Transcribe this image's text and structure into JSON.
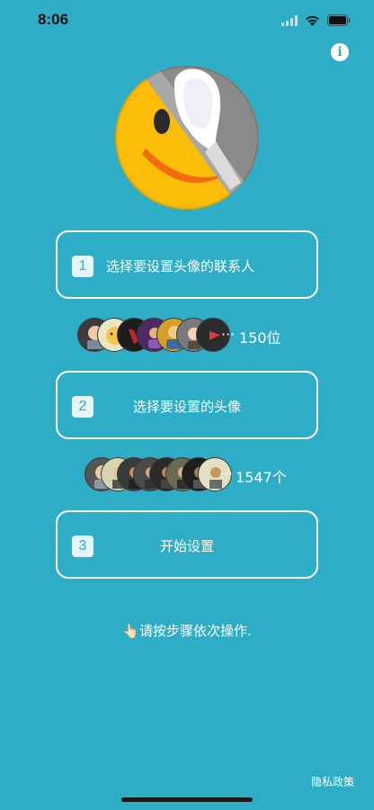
{
  "status_bar": {
    "time": "8:06"
  },
  "steps": [
    {
      "number": "1",
      "label": "选择要设置头像的联系人"
    },
    {
      "number": "2",
      "label": "选择要设置的头像"
    },
    {
      "number": "3",
      "label": "开始设置"
    }
  ],
  "contacts_summary": {
    "ellipsis": "···",
    "count": "150位"
  },
  "avatars_summary": {
    "ellipsis": "···",
    "count": "1547个"
  },
  "hint": {
    "icon": "👆🏻",
    "text": "请按步骤依次操作."
  },
  "footer": {
    "privacy_link": "隐私政策"
  },
  "colors": {
    "background": "#2eadc6",
    "card_border": "#ffffff",
    "step_badge_bg": "#e4f4f8"
  },
  "icons": [
    "wifi-icon",
    "cellular-signal-icon",
    "battery-icon",
    "info-icon",
    "app-logo-icon"
  ]
}
